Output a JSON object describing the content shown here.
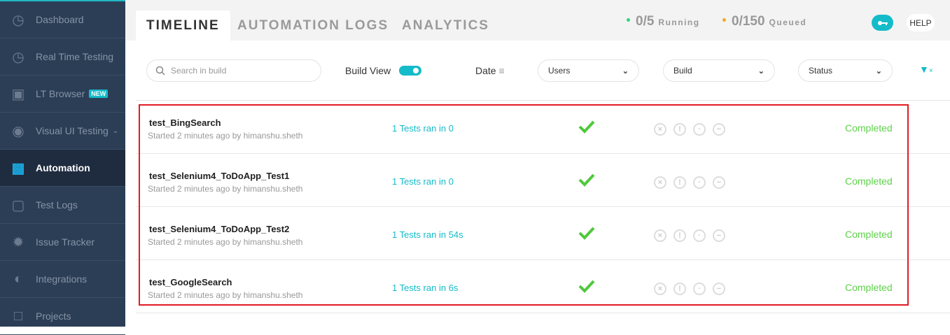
{
  "sidebar": {
    "items": [
      {
        "label": "Dashboard",
        "icon": "gauge-icon"
      },
      {
        "label": "Real Time Testing",
        "icon": "clock-icon"
      },
      {
        "label": "LT Browser",
        "icon": "browser-icon",
        "badge": "NEW"
      },
      {
        "label": "Visual UI Testing",
        "icon": "eye-icon"
      },
      {
        "label": "Automation",
        "icon": "robot-icon",
        "active": true
      },
      {
        "label": "Test Logs",
        "icon": "box-icon"
      },
      {
        "label": "Issue Tracker",
        "icon": "bug-icon"
      },
      {
        "label": "Integrations",
        "icon": "integrations-icon"
      },
      {
        "label": "Projects",
        "icon": "folder-icon"
      }
    ]
  },
  "tabs": [
    "TIMELINE",
    "AUTOMATION LOGS",
    "ANALYTICS"
  ],
  "stats": {
    "running_value": "0/5",
    "running_label": "Running",
    "queued_value": "0/150",
    "queued_label": "Queued",
    "running_color": "#2ed47a",
    "queued_color": "#f5a623"
  },
  "help_label": "HELP",
  "filters": {
    "search_placeholder": "Search in build",
    "build_view_label": "Build View",
    "build_view_on": true,
    "date_label": "Date",
    "users": "Users",
    "build": "Build",
    "status": "Status"
  },
  "builds": [
    {
      "name": "test_BingSearch",
      "started": "Started 2 minutes ago by himanshu.sheth",
      "ran": "1 Tests ran in 0",
      "status": "Completed"
    },
    {
      "name": "test_Selenium4_ToDoApp_Test1",
      "started": "Started 2 minutes ago by himanshu.sheth",
      "ran": "1 Tests ran in 0",
      "status": "Completed"
    },
    {
      "name": "test_Selenium4_ToDoApp_Test2",
      "started": "Started 2 minutes ago by himanshu.sheth",
      "ran": "1 Tests ran in 54s",
      "status": "Completed"
    },
    {
      "name": "test_GoogleSearch",
      "started": "Started 2 minutes ago by himanshu.sheth",
      "ran": "1 Tests ran in 6s",
      "status": "Completed"
    }
  ]
}
